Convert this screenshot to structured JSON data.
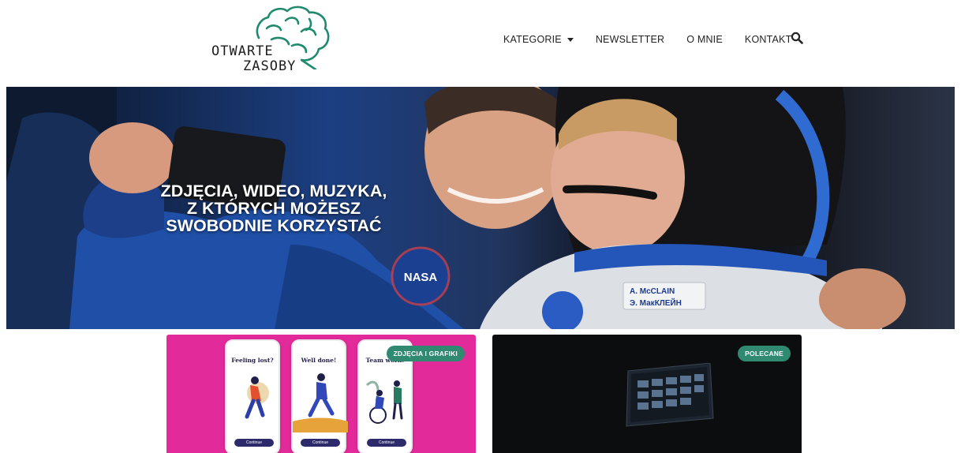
{
  "site": {
    "logo_line1": "OTWARTE",
    "logo_line2": "ZASOBY"
  },
  "nav": {
    "items": [
      {
        "label": "KATEGORIE",
        "has_dropdown": true
      },
      {
        "label": "NEWSLETTER",
        "has_dropdown": false
      },
      {
        "label": "O MNIE",
        "has_dropdown": false
      },
      {
        "label": "KONTAKT",
        "has_dropdown": false
      }
    ],
    "search_icon": "search-icon"
  },
  "hero": {
    "title_line1": "ZDJĘCIA, WIDEO, MUZYKA,",
    "title_line2": "Z KTÓRYCH MOŻESZ",
    "title_line3": "SWOBODNIE KORZYSTAĆ",
    "patch_text": "NASA",
    "name_tag_1": "A. McCLAIN",
    "name_tag_2": "Э. МакКЛЕЙН"
  },
  "cards": [
    {
      "badge": "ZDJĘCIA I GRAFIKI",
      "phones": [
        {
          "title": "Feeling lost?",
          "button": "Continue"
        },
        {
          "title": "Well done!",
          "button": "Continue"
        },
        {
          "title": "Team work!",
          "button": "Continue"
        }
      ]
    },
    {
      "badge": "POLECANE"
    }
  ],
  "colors": {
    "accent_green": "#2f8a71",
    "logo_green": "#1f8a6e",
    "card_left_bg": "#e32a9a",
    "card_right_bg": "#0b0d0f"
  }
}
